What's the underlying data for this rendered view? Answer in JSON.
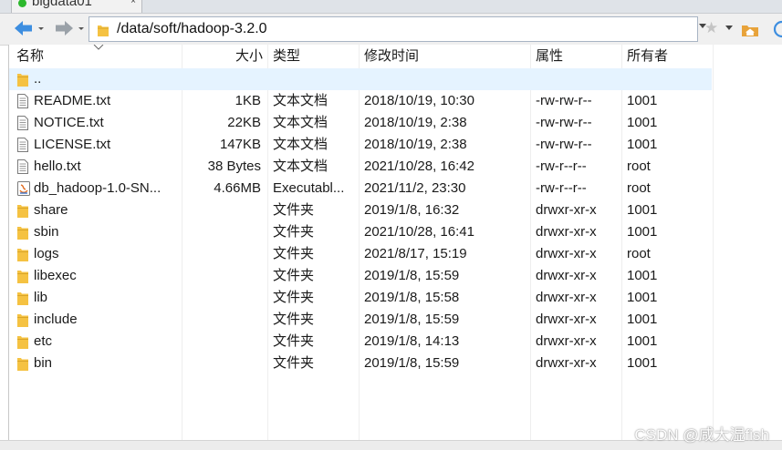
{
  "tab": {
    "title": "bigdata01",
    "close": "×"
  },
  "address": {
    "path": "/data/soft/hadoop-3.2.0"
  },
  "columns": {
    "name": "名称",
    "size": "大小",
    "type": "类型",
    "modified": "修改时间",
    "attributes": "属性",
    "owner": "所有者"
  },
  "rows": [
    {
      "icon": "folder-icon",
      "name": "..",
      "size": "",
      "type": "",
      "modified": "",
      "attributes": "",
      "owner": ""
    },
    {
      "icon": "text-file-icon",
      "name": "README.txt",
      "size": "1KB",
      "type": "文本文档",
      "modified": "2018/10/19, 10:30",
      "attributes": "-rw-rw-r--",
      "owner": "1001"
    },
    {
      "icon": "text-file-icon",
      "name": "NOTICE.txt",
      "size": "22KB",
      "type": "文本文档",
      "modified": "2018/10/19, 2:38",
      "attributes": "-rw-rw-r--",
      "owner": "1001"
    },
    {
      "icon": "text-file-icon",
      "name": "LICENSE.txt",
      "size": "147KB",
      "type": "文本文档",
      "modified": "2018/10/19, 2:38",
      "attributes": "-rw-rw-r--",
      "owner": "1001"
    },
    {
      "icon": "text-file-icon",
      "name": "hello.txt",
      "size": "38 Bytes",
      "type": "文本文档",
      "modified": "2021/10/28, 16:42",
      "attributes": "-rw-r--r--",
      "owner": "root"
    },
    {
      "icon": "jar-file-icon",
      "name": "db_hadoop-1.0-SN...",
      "size": "4.66MB",
      "type": "Executabl...",
      "modified": "2021/11/2, 23:30",
      "attributes": "-rw-r--r--",
      "owner": "root"
    },
    {
      "icon": "folder-icon",
      "name": "share",
      "size": "",
      "type": "文件夹",
      "modified": "2019/1/8, 16:32",
      "attributes": "drwxr-xr-x",
      "owner": "1001"
    },
    {
      "icon": "folder-icon",
      "name": "sbin",
      "size": "",
      "type": "文件夹",
      "modified": "2021/10/28, 16:41",
      "attributes": "drwxr-xr-x",
      "owner": "1001"
    },
    {
      "icon": "folder-icon",
      "name": "logs",
      "size": "",
      "type": "文件夹",
      "modified": "2021/8/17, 15:19",
      "attributes": "drwxr-xr-x",
      "owner": "root"
    },
    {
      "icon": "folder-icon",
      "name": "libexec",
      "size": "",
      "type": "文件夹",
      "modified": "2019/1/8, 15:59",
      "attributes": "drwxr-xr-x",
      "owner": "1001"
    },
    {
      "icon": "folder-icon",
      "name": "lib",
      "size": "",
      "type": "文件夹",
      "modified": "2019/1/8, 15:58",
      "attributes": "drwxr-xr-x",
      "owner": "1001"
    },
    {
      "icon": "folder-icon",
      "name": "include",
      "size": "",
      "type": "文件夹",
      "modified": "2019/1/8, 15:59",
      "attributes": "drwxr-xr-x",
      "owner": "1001"
    },
    {
      "icon": "folder-icon",
      "name": "etc",
      "size": "",
      "type": "文件夹",
      "modified": "2019/1/8, 14:13",
      "attributes": "drwxr-xr-x",
      "owner": "1001"
    },
    {
      "icon": "folder-icon",
      "name": "bin",
      "size": "",
      "type": "文件夹",
      "modified": "2019/1/8, 15:59",
      "attributes": "drwxr-xr-x",
      "owner": "1001"
    }
  ],
  "watermark": "CSDN @咸大湿fish",
  "colors": {
    "folder": "#f5c242",
    "selection": "#e5f3ff",
    "nav_arrow": "#3d8ee0",
    "toolbar": "#f0f0f0"
  }
}
